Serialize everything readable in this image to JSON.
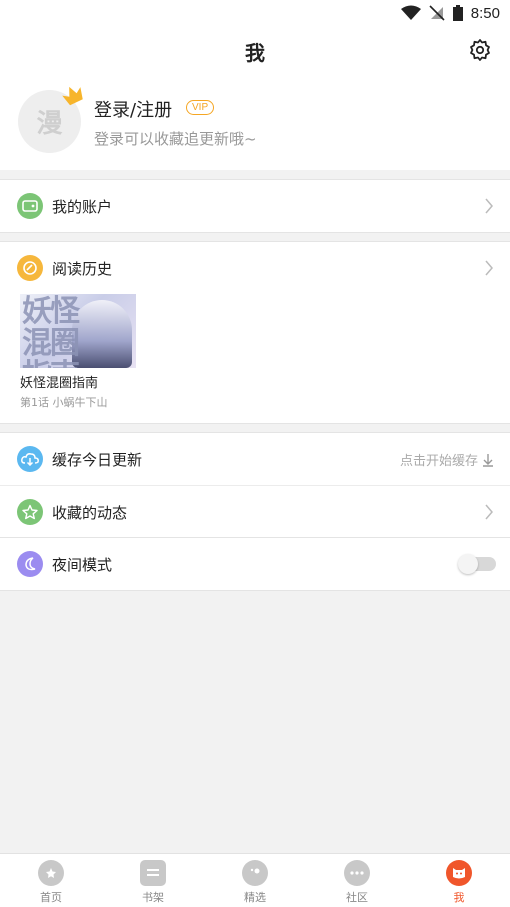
{
  "status_bar": {
    "time": "8:50"
  },
  "header": {
    "title": "我"
  },
  "profile": {
    "avatar_text": "漫",
    "login_label": "登录/注册",
    "vip_badge": "VIP",
    "subtitle": "登录可以收藏追更新哦~"
  },
  "menu": {
    "account": {
      "label": "我的账户"
    },
    "history": {
      "label": "阅读历史",
      "items": [
        {
          "cover_text": "妖怪混圈指南",
          "title": "妖怪混圈指南",
          "progress": "第1话  小蜗牛下山"
        }
      ]
    },
    "cache": {
      "label": "缓存今日更新",
      "hint": "点击开始缓存"
    },
    "favorites_activity": {
      "label": "收藏的动态"
    },
    "night_mode": {
      "label": "夜间模式",
      "enabled": false
    }
  },
  "tabbar": {
    "tabs": [
      {
        "label": "首页",
        "icon": "home-icon",
        "active": false
      },
      {
        "label": "书架",
        "icon": "bookshelf-icon",
        "active": false
      },
      {
        "label": "精选",
        "icon": "featured-icon",
        "active": false
      },
      {
        "label": "社区",
        "icon": "community-icon",
        "active": false
      },
      {
        "label": "我",
        "icon": "me-icon",
        "active": true
      }
    ]
  },
  "colors": {
    "accent": "#f0562b",
    "vip": "#f5a623",
    "account_icon": "#7cc576",
    "history_icon": "#f6b73c",
    "cache_icon": "#5bb8f0",
    "favorites_icon": "#7cc576",
    "night_icon": "#9b8cf0"
  }
}
